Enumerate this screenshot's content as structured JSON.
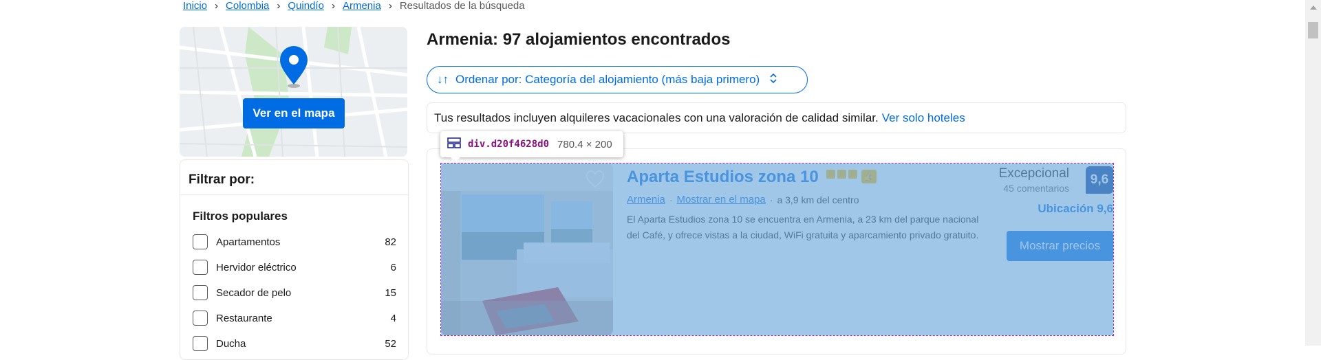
{
  "breadcrumb": {
    "items": [
      "Inicio",
      "Colombia",
      "Quindío",
      "Armenia"
    ],
    "current": "Resultados de la búsqueda"
  },
  "map": {
    "button_label": "Ver en el mapa"
  },
  "filters": {
    "title": "Filtrar por:",
    "popular_title": "Filtros populares",
    "items": [
      {
        "label": "Apartamentos",
        "count": "82"
      },
      {
        "label": "Hervidor eléctrico",
        "count": "6"
      },
      {
        "label": "Secador de pelo",
        "count": "15"
      },
      {
        "label": "Restaurante",
        "count": "4"
      },
      {
        "label": "Ducha",
        "count": "52"
      }
    ]
  },
  "results": {
    "headline": "Armenia: 97 alojamientos encontrados",
    "sort_label": "Ordenar por: Categoría del alojamiento (más baja primero)",
    "notice_text": "Tus resultados incluyen alquileres vacacionales con una valoración de calidad similar.",
    "notice_link": "Ver solo hoteles"
  },
  "property": {
    "name": "Aparta Estudios zona 10",
    "city_link": "Armenia",
    "map_link": "Mostrar en el mapa",
    "distance": "a 3,9 km del centro",
    "description": "El Aparta Estudios zona 10 se encuentra en Armenia, a 23 km del parque nacional del Café, y ofrece vistas a la ciudad, WiFi gratuita y aparcamiento privado gratuito.",
    "rating_word": "Excepcional",
    "review_count": "45 comentarios",
    "score": "9,6",
    "location_score": "Ubicación 9,6",
    "price_button": "Mostrar precios",
    "stars": 3
  },
  "devtools_tooltip": {
    "selector": "div.d20f4628d0",
    "dimensions": "780.4 × 200"
  },
  "colors": {
    "brand_blue": "#006ce4",
    "dark_blue": "#003b95",
    "star_yellow": "#febb02",
    "highlight_overlay": "#6fa8dc"
  }
}
